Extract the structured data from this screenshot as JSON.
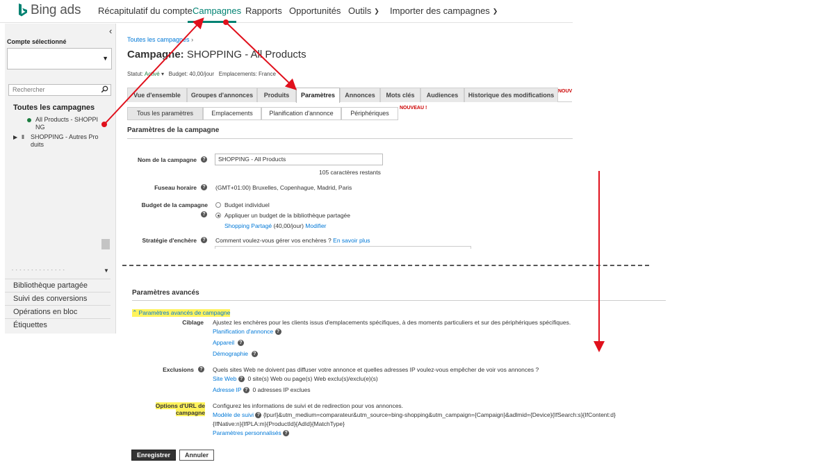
{
  "colors": {
    "accent": "#008272",
    "link": "#0078d7",
    "annotation_red": "#e0101c",
    "highlight": "#fff35c"
  },
  "topnav": {
    "logo": "Bing ads",
    "items": [
      "Récapitulatif du compte",
      "Campagnes",
      "Rapports",
      "Opportunités",
      "Outils",
      "Importer des campagnes"
    ],
    "active": "Campagnes"
  },
  "sidebar": {
    "account_label": "Compte sélectionné",
    "account_value": "",
    "search_placeholder": "Rechercher",
    "tree_title": "Toutes les campagnes",
    "campaigns": [
      {
        "line1": "All Products - SHOPPI",
        "line2": "NG",
        "status": "active"
      },
      {
        "line1": "SHOPPING - Autres Pro",
        "line2": "duits",
        "status": "paused"
      }
    ],
    "links": [
      "Bibliothèque partagée",
      "Suivi des conversions",
      "Opérations en bloc",
      "Étiquettes"
    ]
  },
  "main": {
    "breadcrumb": "Toutes les campagnes",
    "breadcrumb_sep": "›",
    "title_prefix": "Campagne:",
    "title": "SHOPPING - All Products",
    "status_label": "Statut:",
    "status_value": "Activé",
    "budget": "Budget: 40,00/jour",
    "locations": "Emplacements: France",
    "tabs": [
      "Vue d'ensemble",
      "Groupes d'annonces",
      "Produits",
      "Paramètres",
      "Annonces",
      "Mots clés",
      "Audiences",
      "Historique des modifications"
    ],
    "active_tab": "Paramètres",
    "tab_badge": "NOUV",
    "subtabs": [
      "Tous les paramètres",
      "Emplacements",
      "Planification d'annonce",
      "Périphériques"
    ],
    "active_subtab": "Tous les paramètres",
    "subtab_badge": "NOUVEAU !",
    "section_title": "Paramètres de la campagne",
    "fields": {
      "name_label": "Nom de la campagne",
      "name_value": "SHOPPING - All Products",
      "name_remaining": "105 caractères restants",
      "timezone_label": "Fuseau horaire",
      "timezone_value": "(GMT+01:00) Bruxelles, Copenhague, Madrid, Paris",
      "budget_label": "Budget de la campagne",
      "budget_opt1": "Budget individuel",
      "budget_opt2": "Appliquer un budget de la bibliothèque partagée",
      "budget_shared_link": "Shopping Partagé",
      "budget_shared_amount": "(40,00/jour)",
      "budget_modify": "Modifier",
      "bid_label": "Stratégie d'enchère",
      "bid_question": "Comment voulez-vous gérer vos enchères ?",
      "bid_learn": "En savoir plus"
    },
    "advanced": {
      "title": "Paramètres avancés",
      "toggle": "Paramètres avancés de campagne",
      "targeting_label": "Ciblage",
      "targeting_desc": "Ajustez les enchères pour les clients issus d'emplacements spécifiques, à des moments particuliers et sur des périphériques spécifiques.",
      "targeting_links": [
        "Planification d'annonce",
        "Appareil",
        "Démographie"
      ],
      "exclusions_label": "Exclusions",
      "exclusions_desc": "Quels sites Web ne doivent pas diffuser votre annonce et quelles adresses IP voulez-vous empêcher de voir vos annonces ?",
      "site_web": "Site Web",
      "site_web_count": "0 site(s) Web ou page(s) Web exclu(s)/exclu(e)(s)",
      "ip": "Adresse IP",
      "ip_count": "0 adresses IP exclues",
      "url_label_1": "Options d'URL de",
      "url_label_2": "campagne",
      "url_desc": "Configurez les informations de suivi et de redirection pour vos annonces.",
      "tracking_label": "Modèle de suivi",
      "tracking_value_1": "{lpurl}&utm_medium=comparateur&utm_source=bing-shopping&utm_campaign={Campaign}&adlmid={Device}{IfSearch:s}{IfContent:d}",
      "tracking_value_2": "{IfNative:n}{IfPLA:m}{ProductId}{AdId}{MatchType}",
      "custom_params": "Paramètres personnalisés"
    },
    "buttons": {
      "save": "Enregistrer",
      "cancel": "Annuler"
    }
  }
}
